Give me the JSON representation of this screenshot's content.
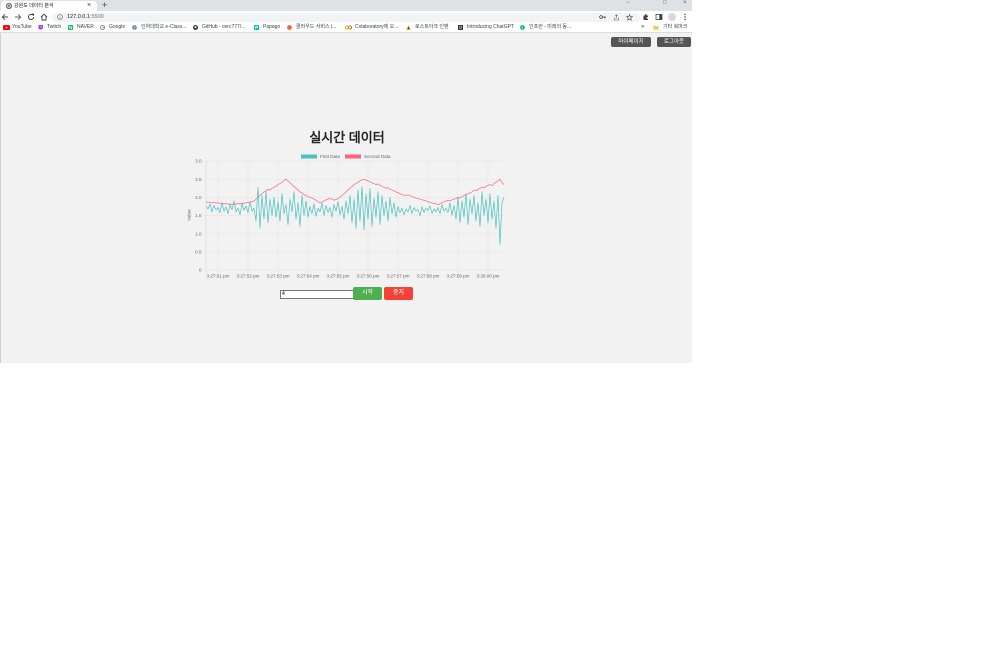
{
  "browser": {
    "tab_title": "강원도 데이터 분석",
    "tab_close": "×",
    "new_tab": "+",
    "window_controls": {
      "minimize": "−",
      "maximize": "□",
      "close": "×"
    },
    "url_host": "127.0.0.1",
    "url_port": ":5500",
    "bookmarks": [
      {
        "label": "YouTube",
        "icon": "youtube-icon",
        "color": "#ff0000"
      },
      {
        "label": "Twitch",
        "icon": "twitch-icon",
        "color": "#9146ff"
      },
      {
        "label": "NAVER",
        "icon": "naver-icon",
        "color": "#03c75a"
      },
      {
        "label": "Google",
        "icon": "google-icon",
        "color": "#6b6b6b"
      },
      {
        "label": "인하대학교 e-Class...",
        "icon": "inha-eclass-icon",
        "color": "#5b7fbf"
      },
      {
        "label": "GitHub - oxrc777/...",
        "icon": "github-icon",
        "color": "#1f2328"
      },
      {
        "label": "Papago",
        "icon": "papago-icon",
        "color": "#00b4ce"
      },
      {
        "label": "클라우드 서비스 |...",
        "icon": "cloud-service-icon",
        "color": "#f46a25"
      },
      {
        "label": "Colaboratory에 오...",
        "icon": "colab-icon",
        "color": "#f9ab00"
      },
      {
        "label": "로스트아크 인벤",
        "icon": "inven-icon",
        "color": "#c9a227"
      },
      {
        "label": "Introducing ChatGPT",
        "icon": "chatgpt-icon",
        "color": "#333333"
      },
      {
        "label": "인프런 - 미래의 동...",
        "icon": "inflearn-icon",
        "color": "#00c471"
      }
    ],
    "bookmarks_overflow": "»",
    "other_bookmarks": "기타 북마크"
  },
  "header": {
    "mypage_label": "마이페이지",
    "logout_label": "로그아웃"
  },
  "page": {
    "title": "실시간 데이터"
  },
  "form": {
    "input_value": "4",
    "start_label": "시작",
    "stop_label": "중지"
  },
  "colors": {
    "start_button": "#4caf50",
    "stop_button": "#f44336",
    "header_button": "#555555",
    "page_background": "#f2f2f2"
  },
  "chart_data": {
    "type": "line",
    "ylabel": "Value",
    "ylim": [
      0,
      3
    ],
    "y_ticks": [
      "0",
      "0.5",
      "1.0",
      "1.5",
      "2.0",
      "2.5",
      "3.0"
    ],
    "x_ticks": [
      "3:27:51 pm",
      "3:27:52 pm",
      "3:27:53 pm",
      "3:27:54 pm",
      "3:27:55 pm",
      "3:27:56 pm",
      "3:27:57 pm",
      "3:27:58 pm",
      "3:27:59 pm",
      "3:28:00 pm"
    ],
    "grid": true,
    "legend_position": "top",
    "series": [
      {
        "name": "First Data",
        "color": "#4bc0c0",
        "values": [
          1.75,
          1.68,
          1.82,
          1.6,
          1.78,
          1.65,
          1.72,
          1.58,
          1.85,
          1.62,
          1.74,
          1.55,
          1.8,
          1.66,
          1.9,
          1.6,
          1.7,
          1.52,
          1.83,
          1.64,
          1.76,
          1.58,
          1.88,
          1.62,
          1.7,
          1.35,
          2.28,
          1.15,
          2.05,
          1.4,
          2.15,
          1.3,
          1.95,
          1.5,
          2.0,
          1.45,
          1.88,
          1.35,
          2.1,
          1.55,
          1.8,
          1.25,
          1.95,
          1.6,
          2.15,
          1.4,
          1.85,
          1.2,
          2.05,
          1.5,
          1.9,
          1.45,
          1.75,
          1.55,
          1.82,
          1.48,
          1.7,
          1.6,
          1.85,
          1.5,
          1.78,
          1.58,
          1.72,
          1.45,
          1.8,
          1.62,
          1.88,
          1.52,
          1.76,
          1.4,
          1.9,
          1.55,
          2.05,
          1.3,
          1.95,
          1.15,
          2.2,
          1.35,
          2.3,
          1.1,
          2.1,
          1.4,
          2.25,
          1.2,
          1.98,
          1.45,
          2.15,
          1.25,
          2.05,
          1.5,
          1.9,
          1.35,
          2.0,
          1.55,
          1.85,
          1.45,
          1.75,
          1.58,
          1.7,
          1.52,
          1.68,
          1.6,
          1.78,
          1.55,
          1.72,
          1.62,
          1.66,
          1.5,
          1.74,
          1.58,
          1.7,
          1.64,
          1.76,
          1.56,
          1.68,
          1.6,
          1.72,
          1.55,
          1.8,
          1.62,
          1.7,
          1.58,
          1.85,
          1.5,
          1.78,
          1.4,
          2.0,
          1.3,
          1.9,
          1.45,
          2.1,
          1.25,
          1.95,
          1.55,
          2.05,
          1.35,
          1.85,
          1.2,
          2.15,
          1.5,
          1.95,
          1.3,
          2.1,
          1.4,
          1.9,
          1.15,
          2.05,
          0.7,
          1.85,
          2.0
        ]
      },
      {
        "name": "Second Data",
        "color": "#ff6384",
        "values": [
          1.88,
          1.86,
          1.87,
          1.85,
          1.86,
          1.84,
          1.85,
          1.83,
          1.84,
          1.82,
          1.83,
          1.81,
          1.82,
          1.8,
          1.82,
          1.81,
          1.83,
          1.82,
          1.84,
          1.83,
          1.86,
          1.85,
          1.88,
          1.87,
          1.9,
          1.95,
          2.0,
          2.05,
          2.1,
          2.15,
          2.18,
          2.22,
          2.2,
          2.25,
          2.28,
          2.3,
          2.35,
          2.38,
          2.42,
          2.46,
          2.5,
          2.45,
          2.4,
          2.35,
          2.3,
          2.25,
          2.2,
          2.15,
          2.12,
          2.08,
          2.05,
          2.02,
          2.0,
          1.98,
          1.95,
          1.92,
          1.88,
          1.85,
          1.87,
          1.9,
          1.93,
          1.95,
          1.97,
          1.95,
          1.92,
          1.94,
          1.97,
          2.0,
          2.05,
          2.1,
          2.15,
          2.2,
          2.25,
          2.3,
          2.35,
          2.38,
          2.42,
          2.45,
          2.48,
          2.5,
          2.47,
          2.45,
          2.43,
          2.4,
          2.38,
          2.35,
          2.37,
          2.33,
          2.3,
          2.28,
          2.25,
          2.27,
          2.22,
          2.2,
          2.18,
          2.15,
          2.13,
          2.1,
          2.08,
          2.06,
          2.05,
          2.07,
          2.05,
          2.02,
          2.0,
          1.98,
          1.97,
          1.95,
          1.93,
          1.92,
          1.9,
          1.88,
          1.86,
          1.85,
          1.83,
          1.82,
          1.8,
          1.82,
          1.85,
          1.88,
          1.9,
          1.92,
          1.9,
          1.93,
          1.95,
          1.97,
          2.0,
          1.98,
          2.02,
          2.05,
          2.08,
          2.1,
          2.12,
          2.15,
          2.2,
          2.18,
          2.22,
          2.25,
          2.28,
          2.26,
          2.3,
          2.33,
          2.35,
          2.32,
          2.38,
          2.42,
          2.45,
          2.5,
          2.4,
          2.35
        ]
      }
    ]
  }
}
